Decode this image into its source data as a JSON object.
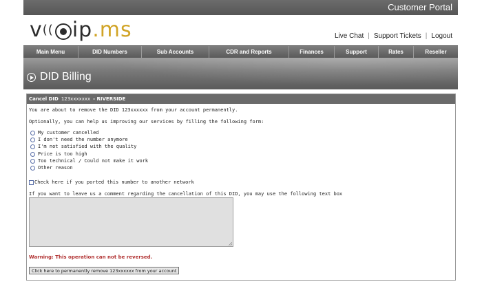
{
  "topbar": {
    "title": "Customer Portal"
  },
  "logo": {
    "voip_text": "voip",
    "ms_text": ".ms",
    "accent": "#d1a426"
  },
  "toplinks": {
    "live_chat": "Live Chat",
    "support_tickets": "Support Tickets",
    "logout": "Logout"
  },
  "nav": {
    "items": [
      {
        "label": "Main Menu"
      },
      {
        "label": "DID Numbers"
      },
      {
        "label": "Sub Accounts"
      },
      {
        "label": "CDR and Reports"
      },
      {
        "label": "Finances"
      },
      {
        "label": "Support"
      },
      {
        "label": "Rates"
      },
      {
        "label": "Reseller"
      }
    ]
  },
  "banner": {
    "title": "DID Billing"
  },
  "panel": {
    "header_prefix": "Cancel DID",
    "header_did": "123xxxxxxx",
    "header_suffix": "- RIVERSIDE",
    "intro_1": "You are about to remove the DID  123xxxxxx  from your account permanently.",
    "intro_2": "Optionally, you can help us improving our services by filling the following form:",
    "reasons": [
      {
        "label": "My customer cancelled"
      },
      {
        "label": "I don't need the number anymore"
      },
      {
        "label": "I'm not satisfied with the quality"
      },
      {
        "label": "Price is too high"
      },
      {
        "label": "Too technical / Could not make it work"
      },
      {
        "label": "Other reason"
      }
    ],
    "ported_check_label": "Check here if you ported this number to another network",
    "comment_prompt": "If you want to leave us a comment regarding the cancellation of this DID, you may use the following text box",
    "comment_value": "",
    "warning": "Warning: This operation can not be reversed.",
    "submit_label": "Click here to permanently remove  123xxxxxx  from your account"
  }
}
